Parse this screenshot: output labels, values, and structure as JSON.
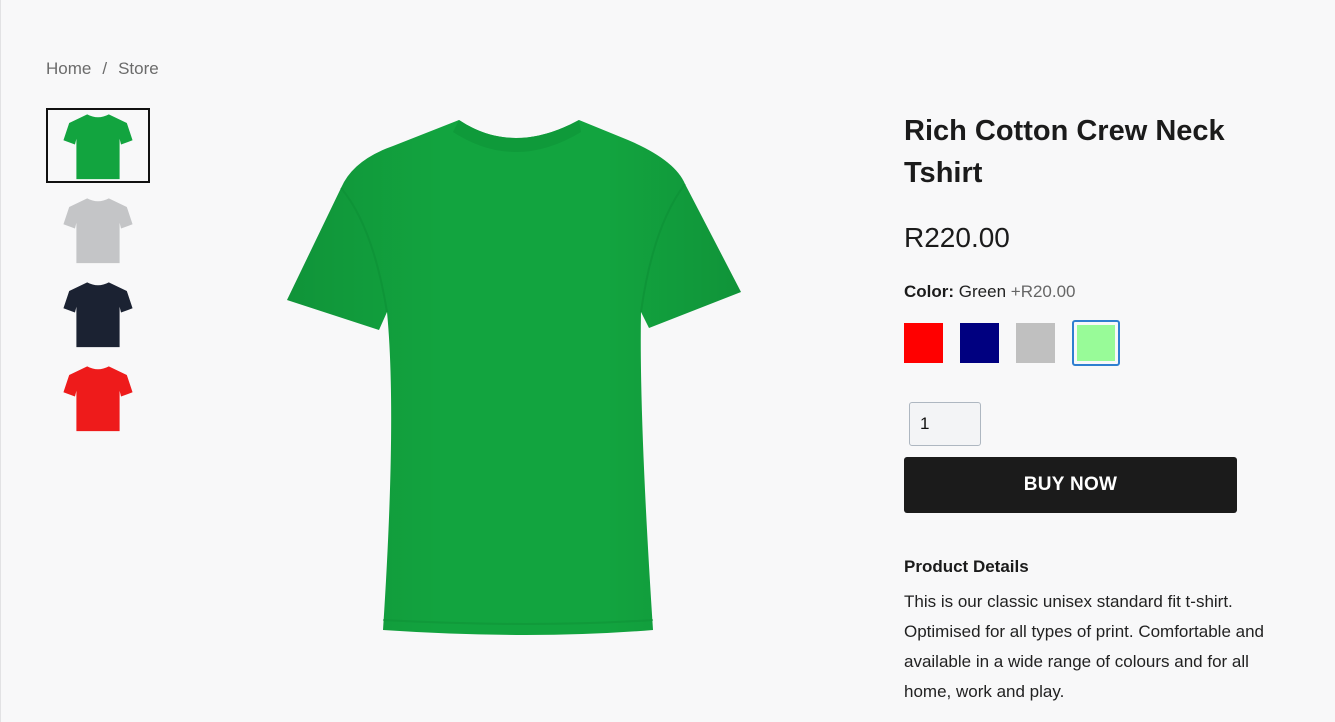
{
  "breadcrumb": {
    "home": "Home",
    "separator": "/",
    "store": "Store"
  },
  "thumbnails": [
    {
      "color": "#12a43f",
      "name": "green"
    },
    {
      "color": "#c4c5c7",
      "name": "grey"
    },
    {
      "color": "#1b2232",
      "name": "navy"
    },
    {
      "color": "#ee1b1b",
      "name": "red"
    }
  ],
  "main_image": {
    "color": "#12a43f"
  },
  "product": {
    "title": "Rich Cotton Crew Neck Tshirt",
    "price": "R220.00",
    "color_label": "Color:",
    "color_value": "Green",
    "color_extra": "+R20.00",
    "swatches": [
      {
        "color": "#ff0000",
        "name": "red",
        "selected": false
      },
      {
        "color": "#000080",
        "name": "navy",
        "selected": false
      },
      {
        "color": "#c0c0c0",
        "name": "silver",
        "selected": false
      },
      {
        "color": "#98fb98",
        "name": "green",
        "selected": true
      }
    ],
    "quantity": "1",
    "buy_label": "BUY NOW",
    "details_heading": "Product Details",
    "details_text": "This is our classic unisex standard fit t-shirt. Optimised for all types of print. Comfortable and available in a wide range of colours and for all home, work and play."
  }
}
